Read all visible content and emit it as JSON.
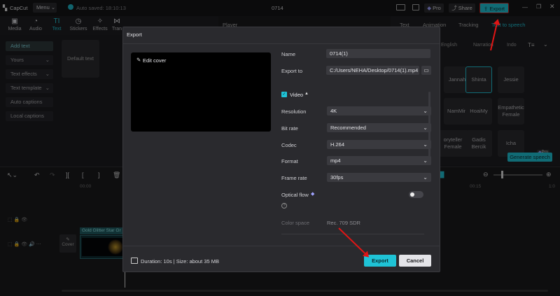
{
  "app": {
    "name": "CapCut",
    "menu": "Menu",
    "autosave": "Auto saved: 18:10:13",
    "project": "0714",
    "pro_badge": "Pro",
    "share": "Share",
    "export": "Export"
  },
  "toolbar": {
    "items": [
      "Media",
      "Audio",
      "Text",
      "Stickers",
      "Effects",
      "Tran"
    ]
  },
  "sidebar": {
    "items": [
      "Add text",
      "Yours",
      "Text effects",
      "Text template",
      "Auto captions",
      "Local captions"
    ],
    "default_text": "Default text"
  },
  "player": {
    "label": "Player"
  },
  "right_panel": {
    "tabs": [
      "Text",
      "Animation",
      "Tracking",
      "Text to speech"
    ],
    "filters": [
      "English",
      "Narration",
      "Indo"
    ],
    "voices": [
      "Jannah",
      "Shinta",
      "Jessie",
      "NamMin",
      "HoaiMy",
      "Empathetic Female",
      "oryteller Female",
      "Gadis Bercik",
      "Icha"
    ],
    "generate": "Generate speech",
    "pro_badge": "Pro"
  },
  "timeline": {
    "time_left": "00:00",
    "time_right": "00:15",
    "time_far": "1:0",
    "clip_label": "Gold Glitter Star Gr",
    "cover_label": "Cover"
  },
  "dialog": {
    "title": "Export",
    "edit_cover": "Edit cover",
    "name_label": "Name",
    "name_value": "0714(1)",
    "export_to_label": "Export to",
    "export_to_value": "C:/Users/NEHA/Desktop/0714(1).mp4",
    "video_section": "Video",
    "resolution_label": "Resolution",
    "resolution_value": "4K",
    "bitrate_label": "Bit rate",
    "bitrate_value": "Recommended",
    "codec_label": "Codec",
    "codec_value": "H.264",
    "format_label": "Format",
    "format_value": "mp4",
    "framerate_label": "Frame rate",
    "framerate_value": "30fps",
    "optical_flow_label": "Optical flow",
    "color_space_label": "Color space",
    "color_space_value": "Rec. 709 SDR",
    "summary": "Duration: 10s | Size: about 35 MB",
    "export_button": "Export",
    "cancel_button": "Cancel"
  },
  "colors": {
    "accent": "#1fc3d6",
    "arrow": "#e01515",
    "bg": "#1c1c1f"
  }
}
